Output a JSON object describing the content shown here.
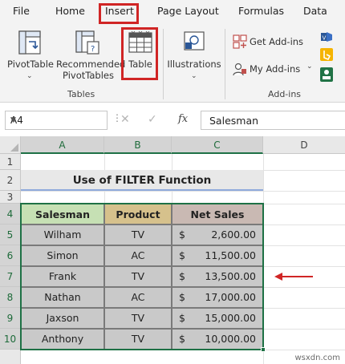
{
  "menu": {
    "tabs": [
      "File",
      "Home",
      "Insert",
      "Page Layout",
      "Formulas",
      "Data"
    ],
    "active": "Insert"
  },
  "ribbon": {
    "tables_group": {
      "pivottable": "PivotTable",
      "recommended_line1": "Recommended",
      "recommended_line2": "PivotTables",
      "table": "Table",
      "label": "Tables"
    },
    "illustrations": "Illustrations",
    "addins_group": {
      "get_addins": "Get Add-ins",
      "my_addins": "My Add-ins",
      "label": "Add-ins"
    }
  },
  "formula_bar": {
    "name_box": "A4",
    "fx": "fx",
    "content": "Salesman"
  },
  "grid": {
    "columns": [
      "A",
      "B",
      "C",
      "D"
    ],
    "rows": [
      "1",
      "2",
      "3",
      "4",
      "5",
      "6",
      "7",
      "8",
      "9",
      "10"
    ],
    "title": "Use of FILTER Function",
    "headers": {
      "salesman": "Salesman",
      "product": "Product",
      "net_sales": "Net Sales"
    },
    "currency": "$",
    "data": [
      {
        "salesman": "Wilham",
        "product": "TV",
        "net_sales": "2,600.00"
      },
      {
        "salesman": "Simon",
        "product": "AC",
        "net_sales": "11,500.00"
      },
      {
        "salesman": "Frank",
        "product": "TV",
        "net_sales": "13,500.00"
      },
      {
        "salesman": "Nathan",
        "product": "AC",
        "net_sales": "17,000.00"
      },
      {
        "salesman": "Jaxson",
        "product": "TV",
        "net_sales": "15,000.00"
      },
      {
        "salesman": "Anthony",
        "product": "TV",
        "net_sales": "10,000.00"
      }
    ]
  },
  "colors": {
    "salesman_header": "#c6e0b4",
    "product_header": "#d6c18c",
    "net_sales_header": "#c9b9b3",
    "table_body": "#c9c9c9",
    "selection": "#1e7145",
    "highlight_red": "#d02525"
  },
  "watermark": "wsxdn.com"
}
